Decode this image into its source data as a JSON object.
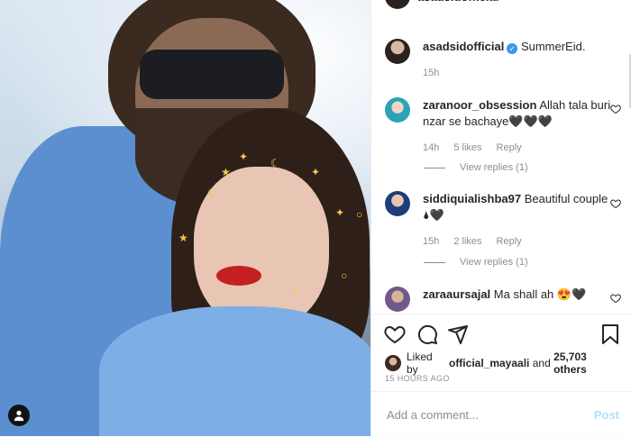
{
  "header_peek": {
    "username": "asadsidofficial",
    "trailing": "g"
  },
  "caption": {
    "username": "asadsidofficial",
    "verified_mark": "✓",
    "text": "SummerEid.",
    "time": "15h"
  },
  "comments": [
    {
      "username": "zaranoor_obsession",
      "text": "Allah tala buri nzar se bachaye🖤🖤🖤",
      "time": "14h",
      "likes": "5 likes",
      "reply": "Reply",
      "view_replies": "View replies (1)"
    },
    {
      "username": "siddiquialishba97",
      "text": "Beautiful couple🌢🖤",
      "time": "15h",
      "likes": "2 likes",
      "reply": "Reply",
      "view_replies": "View replies (1)"
    },
    {
      "username": "zaraaursajal",
      "text": "Ma shall ah 😍🖤"
    }
  ],
  "liked_by": {
    "prefix": "Liked by ",
    "user": "official_mayaali",
    "mid": " and ",
    "count": "25,703 others"
  },
  "timestamp": "15 HOURS AGO",
  "add_comment": {
    "placeholder": "Add a comment...",
    "post_label": "Post"
  },
  "colors": {
    "accent": "#3897f0",
    "post_disabled": "#b2dffc",
    "text": "#262626",
    "muted": "#8e8e8e"
  },
  "icons": [
    "heart-icon",
    "comment-icon",
    "share-icon",
    "bookmark-icon",
    "user-icon"
  ]
}
